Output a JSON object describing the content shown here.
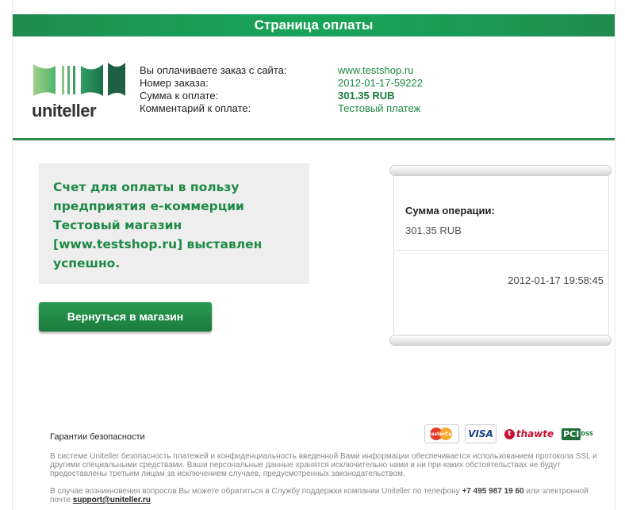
{
  "header": {
    "title": "Страница оплаты"
  },
  "logo": {
    "text": "uniteller"
  },
  "order": {
    "rows": [
      {
        "label": "Вы оплачиваете заказ с сайта:",
        "value": "www.testshop.ru"
      },
      {
        "label": "Номер заказа:",
        "value": "2012-01-17-59222"
      },
      {
        "label": "Сумма к оплате:",
        "value": "301.35 RUB"
      },
      {
        "label": "Комментарий к оплате:",
        "value": "Тестовый платеж"
      }
    ]
  },
  "message": {
    "text": "Счет для оплаты в пользу предприятия е-коммерции Тестовый магазин [www.testshop.ru] выставлен успешно."
  },
  "back_button": {
    "label": "Вернуться в магазин"
  },
  "receipt": {
    "label": "Сумма операции:",
    "amount": "301.35 RUB",
    "datetime": "2012-01-17 19:58:45"
  },
  "security": {
    "title": "Гарантии безопасности",
    "text1": "В системе Uniteller безопасность платежей и конфиденциальность введенной Вами информации обеспечивается использованием протокола SSL и другими специальными средствами. Ваши персональные данные хранятся исключительно нами и ни при каких обстоятельствах не будут предоставлены третьим лицам за исключением случаев, предусмотренных законодательством.",
    "text2_prefix": "В случае возникновения вопросов Вы можете обратиться в Службу поддержки компании Uniteller по телефону",
    "phone": "+7 495 987 19 60",
    "text2_mid": "или электронной почте",
    "email": "support@uniteller.ru",
    "logos": {
      "mastercard": "MasterCard",
      "visa": "VISA",
      "thawte": "thawte",
      "pci": "PCI",
      "dss": "DSS"
    }
  },
  "colors": {
    "brand_green": "#1c9a55",
    "text_green": "#1a8a3f"
  }
}
